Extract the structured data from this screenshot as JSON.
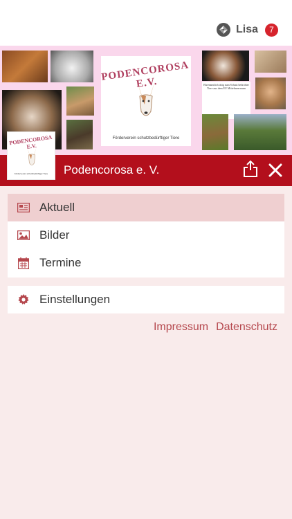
{
  "topbar": {
    "user_name": "Lisa",
    "badge_count": "7"
  },
  "banner": {
    "logo_title": "PODENCOROSA E.V.",
    "logo_subtitle": "Förderverein schutzbedürftiger Tiere",
    "note_text": "Ehrenamtlich tätig zum Schutz bedrohter Tiere aus dem EU Mittelmeerraum"
  },
  "header": {
    "title": "Podencorosa e. V.",
    "logo_title": "PODENCOROSA E.V.",
    "logo_subtitle": "Förderverein schutzbedürftiger Tiere"
  },
  "menu": {
    "items": [
      {
        "label": "Aktuell",
        "icon": "newspaper-icon",
        "active": true
      },
      {
        "label": "Bilder",
        "icon": "image-icon",
        "active": false
      },
      {
        "label": "Termine",
        "icon": "calendar-icon",
        "active": false
      }
    ],
    "settings": {
      "label": "Einstellungen",
      "icon": "gear-icon"
    }
  },
  "links": {
    "impressum": "Impressum",
    "datenschutz": "Datenschutz"
  },
  "colors": {
    "header": "#b30f1c",
    "accent": "#b5474d",
    "background": "#f9ebeb",
    "active_item": "#efcfd0",
    "badge": "#d6232c"
  }
}
